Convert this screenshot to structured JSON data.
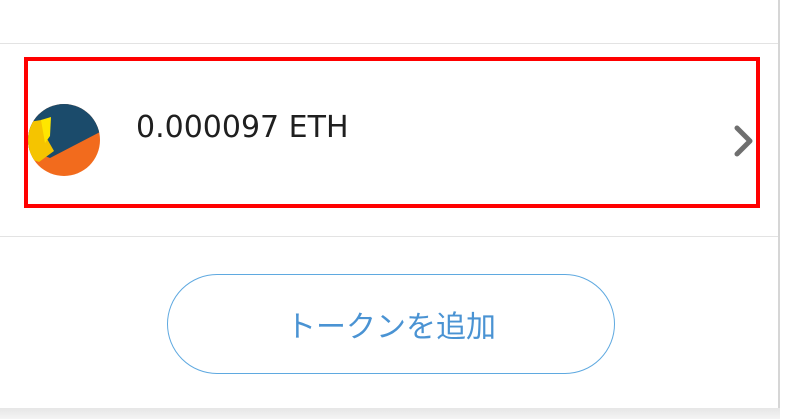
{
  "token": {
    "amount_label": "0.000097 ETH",
    "icon": "token-identicon",
    "icon_colors": [
      "#1b4b6b",
      "#f26b1d",
      "#f5c400"
    ]
  },
  "highlight": {
    "color": "#ff0000"
  },
  "actions": {
    "add_token_label": "トークンを追加"
  },
  "colors": {
    "accent": "#4a93d3",
    "border_accent": "#5fa9e0",
    "divider": "#e3e3e3",
    "chevron": "#6f6f6f"
  }
}
